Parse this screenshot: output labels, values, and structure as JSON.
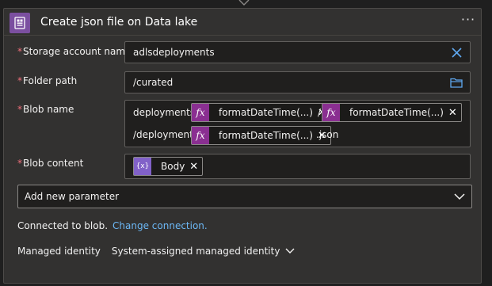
{
  "header": {
    "title": "Create json file on Data lake",
    "more_label": "···"
  },
  "fields": {
    "storage_account": {
      "label": "Storage account name",
      "value": "adlsdeployments"
    },
    "folder_path": {
      "label": "Folder path",
      "value": "/curated"
    },
    "blob_name": {
      "label": "Blob name",
      "segments": {
        "prefix": "deployments/",
        "slash": "/",
        "line2_prefix": "/deployment_",
        "suffix": ".json"
      },
      "tokens": [
        "formatDateTime(...)",
        "formatDateTime(...)",
        "formatDateTime(...)"
      ]
    },
    "blob_content": {
      "label": "Blob content",
      "token": "Body"
    }
  },
  "add_parameter": {
    "label": "Add new parameter"
  },
  "connection": {
    "text": "Connected to blob.",
    "link": "Change connection."
  },
  "identity": {
    "label": "Managed identity",
    "value": "System-assigned managed identity"
  },
  "icons": {
    "header": "storage-blob-icon",
    "clear": "close-icon",
    "folder": "folder-icon",
    "expression": "fx-icon",
    "variable": "dynamic-content-icon"
  },
  "colors": {
    "accent_purple": "#7b4fa0",
    "expression_token": "#8a2f91",
    "link": "#6cb8f6",
    "required": "#f1707b",
    "clear_icon": "#5fa8f0"
  }
}
